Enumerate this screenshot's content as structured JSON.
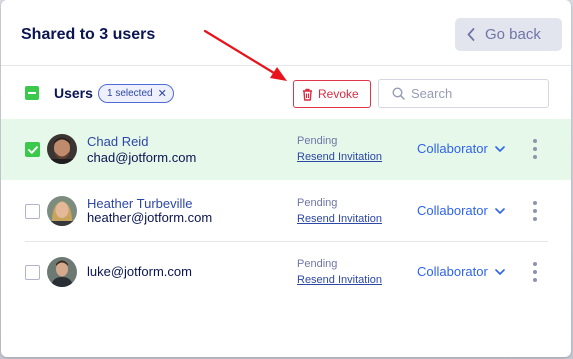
{
  "modal": {
    "title": "Shared to 3 users",
    "back_label": "Go back"
  },
  "toolbar": {
    "users_label": "Users",
    "selected_badge": "1 selected",
    "revoke_label": "Revoke",
    "search_placeholder": "Search",
    "search_value": ""
  },
  "users": [
    {
      "name": "Chad Reid",
      "email": "chad@jotform.com",
      "status": "Pending",
      "action": "Resend Invitation",
      "role": "Collaborator",
      "checked": true
    },
    {
      "name": "Heather Turbeville",
      "email": "heather@jotform.com",
      "status": "Pending",
      "action": "Resend Invitation",
      "role": "Collaborator",
      "checked": false
    },
    {
      "name": "",
      "email": "luke@jotform.com",
      "status": "Pending",
      "action": "Resend Invitation",
      "role": "Collaborator",
      "checked": false
    }
  ],
  "colors": {
    "accent_green": "#3ac84d",
    "revoke_red": "#dc2c41",
    "role_blue": "#2f64ea",
    "annotation_arrow": "#e8141b"
  },
  "icons": [
    "chevron-left-icon",
    "minus-icon",
    "close-icon",
    "trash-icon",
    "search-icon",
    "check-icon",
    "chevron-down-icon",
    "more-vertical-icon"
  ]
}
